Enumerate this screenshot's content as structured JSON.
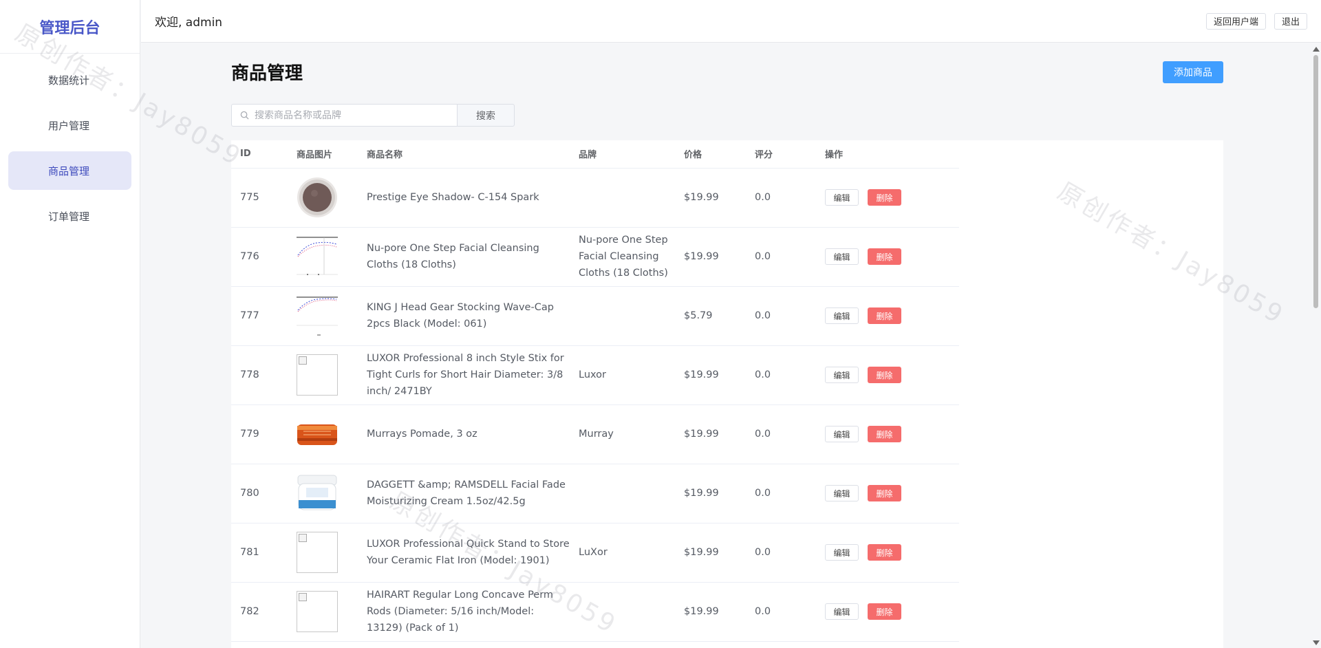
{
  "sidebar": {
    "brand": "管理后台",
    "items": [
      {
        "label": "数据统计"
      },
      {
        "label": "用户管理"
      },
      {
        "label": "商品管理",
        "active": true
      },
      {
        "label": "订单管理"
      }
    ]
  },
  "header": {
    "welcome": "欢迎, admin",
    "back_label": "返回用户端",
    "logout_label": "退出"
  },
  "main": {
    "title": "商品管理",
    "add_label": "添加商品",
    "search": {
      "placeholder": "搜索商品名称或品牌",
      "value": "",
      "button": "搜索"
    },
    "columns": [
      "ID",
      "商品图片",
      "商品名称",
      "品牌",
      "价格",
      "评分",
      "操作"
    ],
    "edit_label": "编辑",
    "delete_label": "删除",
    "rows": [
      {
        "id": "775",
        "name": "Prestige Eye Shadow- C-154 Spark",
        "brand": "",
        "price": "$19.99",
        "rating": "0.0",
        "image": "eyeshadow"
      },
      {
        "id": "776",
        "name": "Nu-pore One Step Facial Cleansing Cloths (18 Cloths)",
        "brand": "Nu-pore One Step Facial Cleansing Cloths (18 Cloths)",
        "price": "$19.99",
        "rating": "0.0",
        "image": "chart-thumb"
      },
      {
        "id": "777",
        "name": "KING J Head Gear Stocking Wave-Cap 2pcs Black (Model: 061)",
        "brand": "",
        "price": "$5.79",
        "rating": "0.0",
        "image": "chart-thumb"
      },
      {
        "id": "778",
        "name": "LUXOR Professional 8 inch Style Stix for Tight Curls for Short Hair Diameter: 3/8 inch/ 2471BY",
        "brand": "Luxor",
        "price": "$19.99",
        "rating": "0.0",
        "image": "broken"
      },
      {
        "id": "779",
        "name": "Murrays Pomade, 3 oz",
        "brand": "Murray",
        "price": "$19.99",
        "rating": "0.0",
        "image": "pomade"
      },
      {
        "id": "780",
        "name": "DAGGETT &amp; RAMSDELL Facial Fade Moisturizing Cream 1.5oz/42.5g",
        "brand": "",
        "price": "$19.99",
        "rating": "0.0",
        "image": "cream"
      },
      {
        "id": "781",
        "name": "LUXOR Professional Quick Stand to Store Your Ceramic Flat Iron (Model: 1901)",
        "brand": "LuXor",
        "price": "$19.99",
        "rating": "0.0",
        "image": "broken"
      },
      {
        "id": "782",
        "name": "HAIRART Regular Long Concave Perm Rods (Diameter: 5/16 inch/Model: 13129) (Pack of 1)",
        "brand": "",
        "price": "$19.99",
        "rating": "0.0",
        "image": "broken"
      }
    ]
  },
  "watermark": "原创作者：Jay8059",
  "colors": {
    "primary": "#409eff",
    "danger": "#f56c6c",
    "brand": "#4a58c8",
    "active_bg": "#e5e7f8"
  }
}
